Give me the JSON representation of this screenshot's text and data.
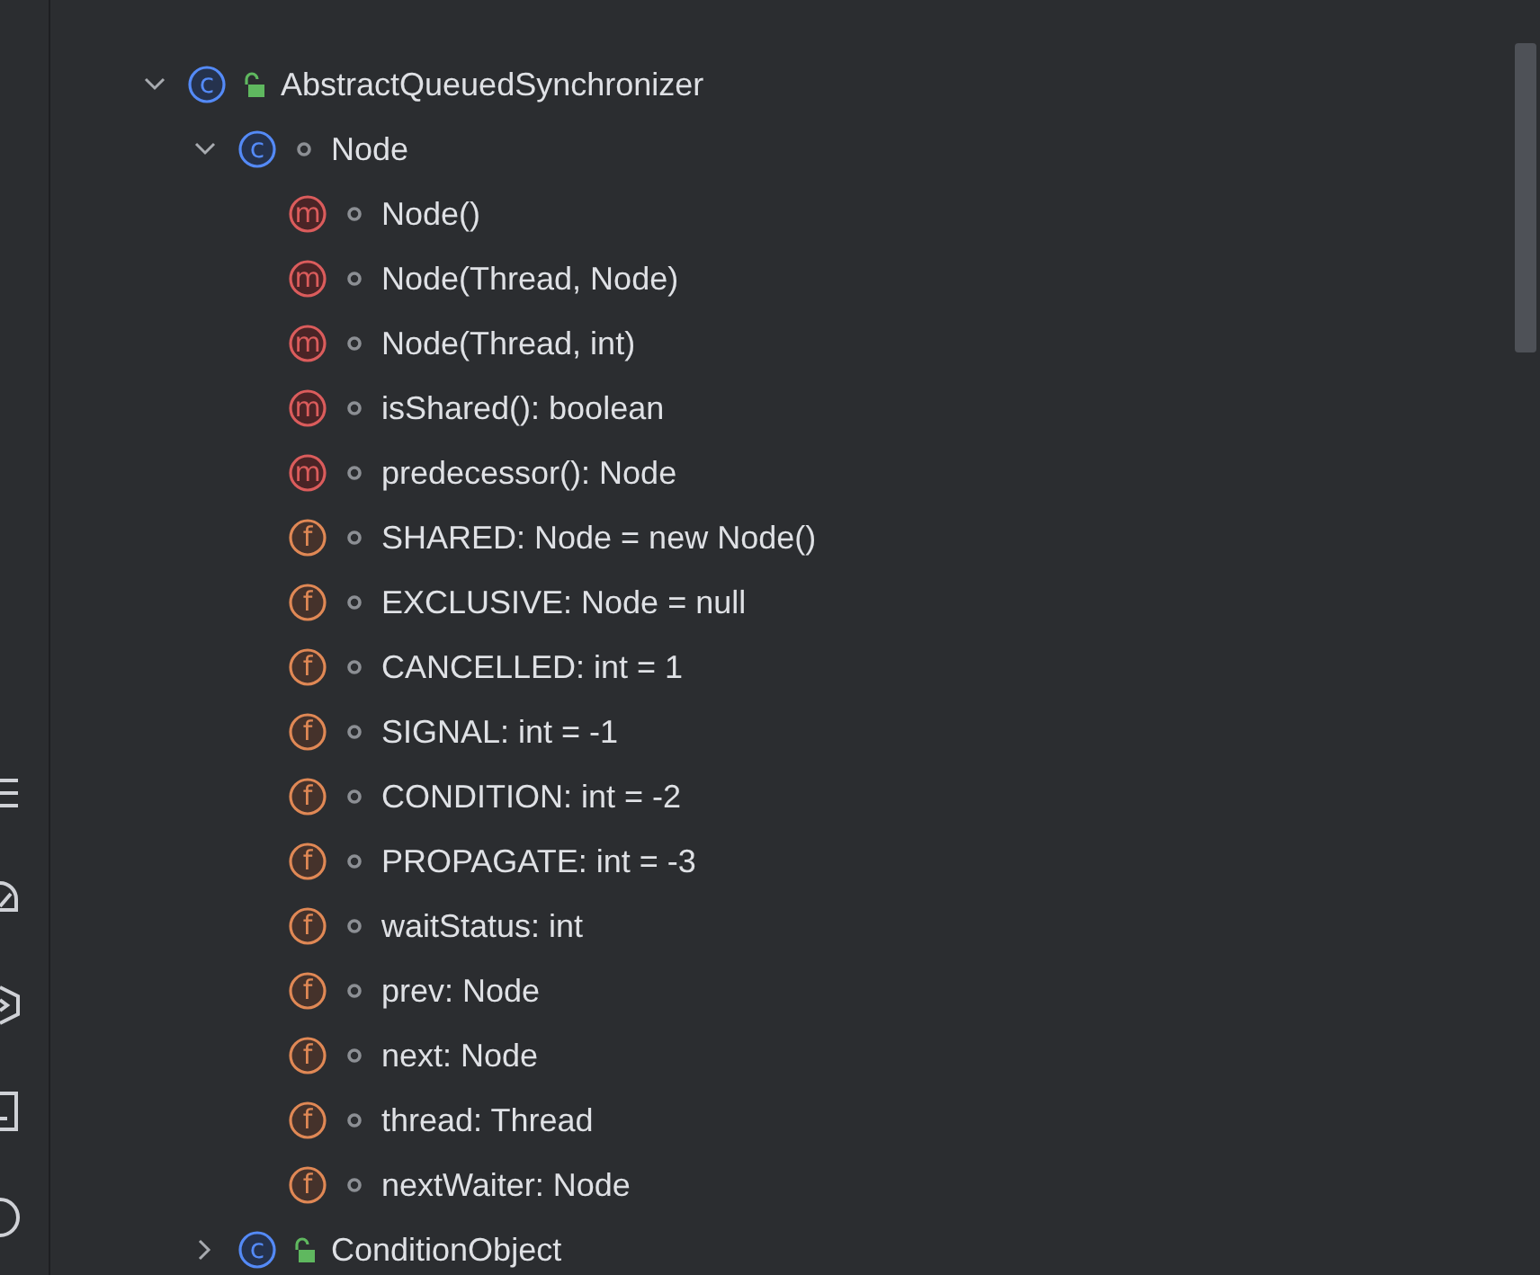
{
  "structure_tree": [
    {
      "kind": "class",
      "icon_letter": "c",
      "public": true,
      "label": "AbstractQueuedSynchronizer",
      "expanded": true,
      "children": [
        {
          "kind": "class",
          "icon_letter": "c",
          "public": false,
          "label": "Node",
          "expanded": true,
          "children": [
            {
              "kind": "method",
              "icon_letter": "m",
              "public": false,
              "label": "Node()"
            },
            {
              "kind": "method",
              "icon_letter": "m",
              "public": false,
              "label": "Node(Thread, Node)"
            },
            {
              "kind": "method",
              "icon_letter": "m",
              "public": false,
              "label": "Node(Thread, int)"
            },
            {
              "kind": "method",
              "icon_letter": "m",
              "public": false,
              "label": "isShared(): boolean"
            },
            {
              "kind": "method",
              "icon_letter": "m",
              "public": false,
              "label": "predecessor(): Node"
            },
            {
              "kind": "field",
              "icon_letter": "f",
              "public": false,
              "label": "SHARED: Node = new Node()"
            },
            {
              "kind": "field",
              "icon_letter": "f",
              "public": false,
              "label": "EXCLUSIVE: Node = null"
            },
            {
              "kind": "field",
              "icon_letter": "f",
              "public": false,
              "label": "CANCELLED: int = 1"
            },
            {
              "kind": "field",
              "icon_letter": "f",
              "public": false,
              "label": "SIGNAL: int = -1"
            },
            {
              "kind": "field",
              "icon_letter": "f",
              "public": false,
              "label": "CONDITION: int = -2"
            },
            {
              "kind": "field",
              "icon_letter": "f",
              "public": false,
              "label": "PROPAGATE: int = -3"
            },
            {
              "kind": "field",
              "icon_letter": "f",
              "public": false,
              "label": "waitStatus: int"
            },
            {
              "kind": "field",
              "icon_letter": "f",
              "public": false,
              "label": "prev: Node"
            },
            {
              "kind": "field",
              "icon_letter": "f",
              "public": false,
              "label": "next: Node"
            },
            {
              "kind": "field",
              "icon_letter": "f",
              "public": false,
              "label": "thread: Thread"
            },
            {
              "kind": "field",
              "icon_letter": "f",
              "public": false,
              "label": "nextWaiter: Node"
            }
          ]
        },
        {
          "kind": "class",
          "icon_letter": "c",
          "public": true,
          "label": "ConditionObject",
          "expanded": false
        }
      ]
    }
  ]
}
